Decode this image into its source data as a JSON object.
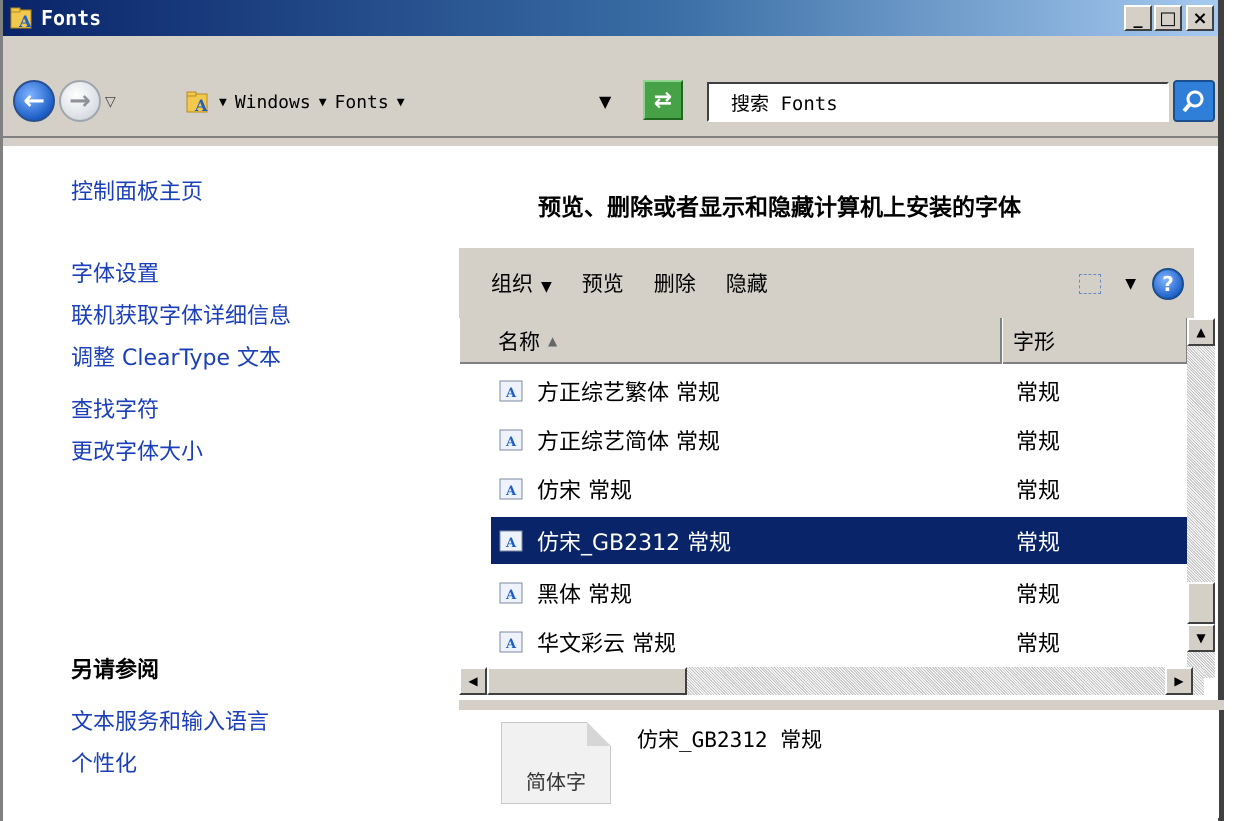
{
  "window": {
    "title": "Fonts",
    "caption_minimize": "_",
    "caption_maximize": "□",
    "caption_close": "×"
  },
  "address_bar": {
    "crumbs": [
      "Windows",
      "Fonts"
    ],
    "search_placeholder": "搜索 Fonts"
  },
  "left_pane": {
    "home_link": "控制面板主页",
    "links": [
      "字体设置",
      "联机获取字体详细信息",
      "调整 ClearType 文本",
      "查找字符",
      "更改字体大小"
    ],
    "see_also_heading": "另请参阅",
    "see_also_links": [
      "文本服务和输入语言",
      "个性化"
    ]
  },
  "main": {
    "title": "预览、删除或者显示和隐藏计算机上安装的字体"
  },
  "toolbar": {
    "organize": "组织",
    "preview": "预览",
    "delete": "删除",
    "hide": "隐藏"
  },
  "list": {
    "columns": [
      "名称",
      "字形"
    ],
    "rows": [
      {
        "name": "方正综艺繁体 常规",
        "style": "常规",
        "selected": false
      },
      {
        "name": "方正综艺简体 常规",
        "style": "常规",
        "selected": false
      },
      {
        "name": "仿宋 常规",
        "style": "常规",
        "selected": false
      },
      {
        "name": "仿宋_GB2312 常规",
        "style": "常规",
        "selected": true
      },
      {
        "name": "黑体 常规",
        "style": "常规",
        "selected": false
      },
      {
        "name": "华文彩云 常规",
        "style": "常规",
        "selected": false
      }
    ]
  },
  "details": {
    "preview_text": "简体字",
    "selected_name": "仿宋_GB2312 常规"
  },
  "colors": {
    "title_bar": "#0a246a",
    "link": "#1a3fb8",
    "selection": "#0a246a",
    "chrome": "#d4d0c8"
  }
}
